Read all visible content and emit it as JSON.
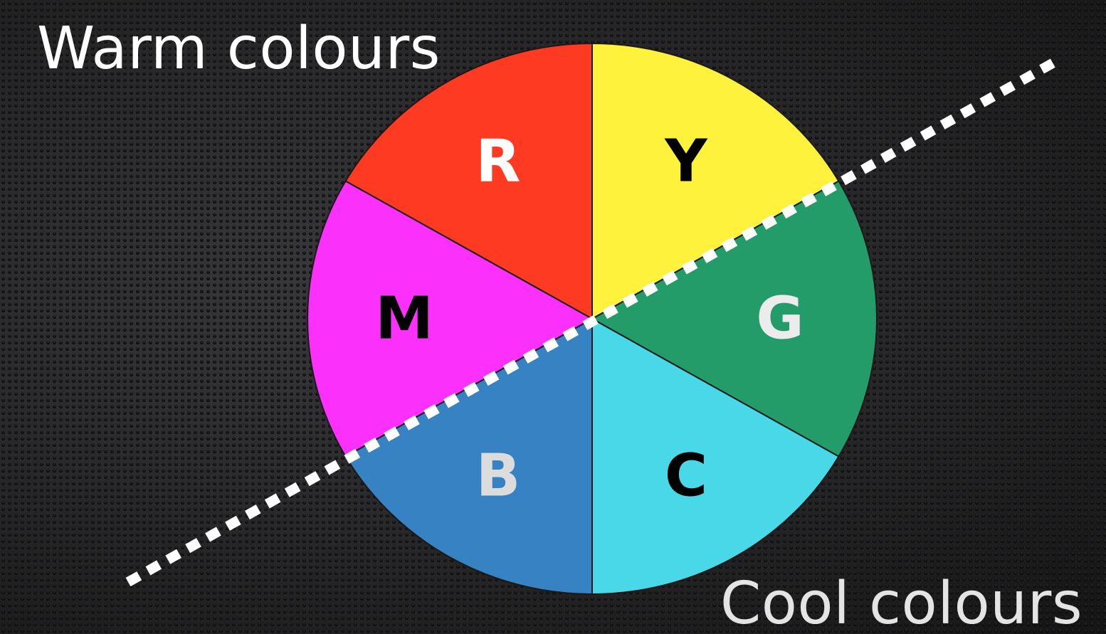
{
  "captions": {
    "warm": "Warm colours",
    "cool": "Cool colours"
  },
  "wheel": {
    "segments": [
      {
        "label": "R",
        "color": "#ff3a22",
        "label_color": "#ffffff"
      },
      {
        "label": "Y",
        "color": "#fff23c",
        "label_color": "#000000"
      },
      {
        "label": "G",
        "color": "#249c6a",
        "label_color": "#ececec"
      },
      {
        "label": "C",
        "color": "#48d8e8",
        "label_color": "#000000"
      },
      {
        "label": "B",
        "color": "#3682c2",
        "label_color": "#dcdcdc"
      },
      {
        "label": "M",
        "color": "#fb30fb",
        "label_color": "#000000"
      }
    ],
    "divider_color": "#ffffff"
  }
}
